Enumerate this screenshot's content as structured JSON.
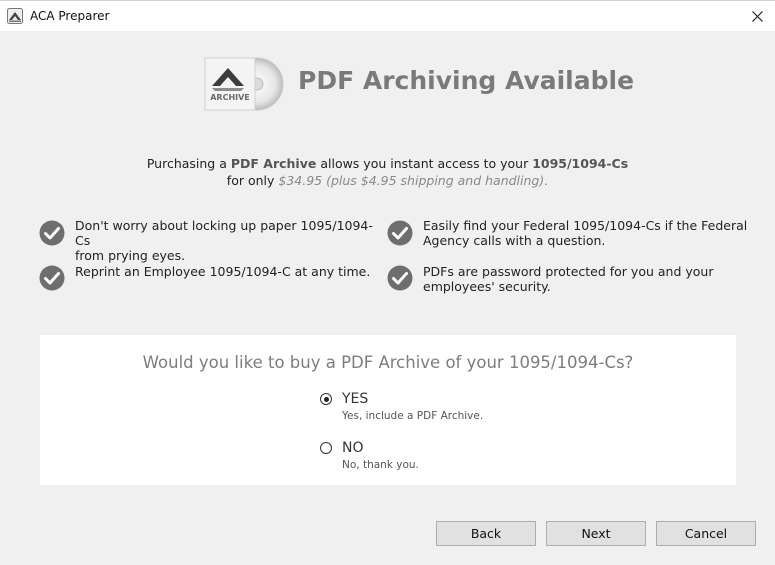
{
  "window": {
    "title": "ACA Preparer",
    "app_icon": "aca-preparer-icon",
    "close_icon": "close-icon"
  },
  "hero": {
    "logo_label": "ARCHIVE",
    "title": "PDF Archiving Available"
  },
  "intro": {
    "line1_prefix": "Purchasing a ",
    "line1_product": "PDF Archive",
    "line1_middle": " allows you instant access to your ",
    "line1_forms": "1095/1094-Cs",
    "line2_prefix": "for only ",
    "line2_price": "$34.95 (plus $4.95 shipping and handling)."
  },
  "features": [
    {
      "icon": "checkmark-icon",
      "line1": "Don't worry about locking up paper 1095/1094-Cs",
      "line2": "from prying eyes."
    },
    {
      "icon": "checkmark-icon",
      "line1": "Easily find your Federal 1095/1094-Cs if the Federal",
      "line2": "Agency calls with a question."
    },
    {
      "icon": "checkmark-icon",
      "line1": "Reprint an Employee 1095/1094-C at any time.",
      "line2": ""
    },
    {
      "icon": "checkmark-icon",
      "line1": "PDFs are password protected for you and your",
      "line2": "employees' security."
    }
  ],
  "question": {
    "text": "Would you like to buy a PDF Archive of your 1095/1094-Cs?",
    "selected": "yes",
    "options": [
      {
        "id": "yes",
        "label": "YES",
        "sublabel": "Yes, include a PDF Archive."
      },
      {
        "id": "no",
        "label": "NO",
        "sublabel": "No, thank you."
      }
    ]
  },
  "buttons": {
    "back": "Back",
    "next": "Next",
    "cancel": "Cancel"
  },
  "colors": {
    "background": "#f0f0f0",
    "panel": "#ffffff",
    "heading_gray": "#7a7a7a",
    "check_fill": "#6e6e6e"
  }
}
